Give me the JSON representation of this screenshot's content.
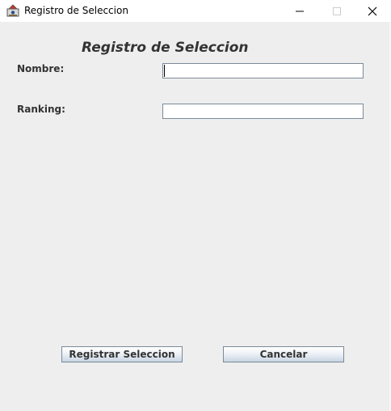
{
  "window": {
    "title": "Registro de Seleccion",
    "icon": "java-app-icon",
    "controls": {
      "minimize_icon": "minimize-icon",
      "maximize_icon": "maximize-icon",
      "close_icon": "close-icon"
    }
  },
  "form": {
    "heading": "Registro de Seleccion",
    "fields": [
      {
        "label": "Nombre:",
        "value": "",
        "placeholder": ""
      },
      {
        "label": "Ranking:",
        "value": "",
        "placeholder": ""
      }
    ]
  },
  "actions": {
    "register_label": "Registrar Seleccion",
    "cancel_label": "Cancelar"
  },
  "colors": {
    "panel_background": "#eeeeee",
    "text": "#333333",
    "field_border": "#7a8a99"
  }
}
